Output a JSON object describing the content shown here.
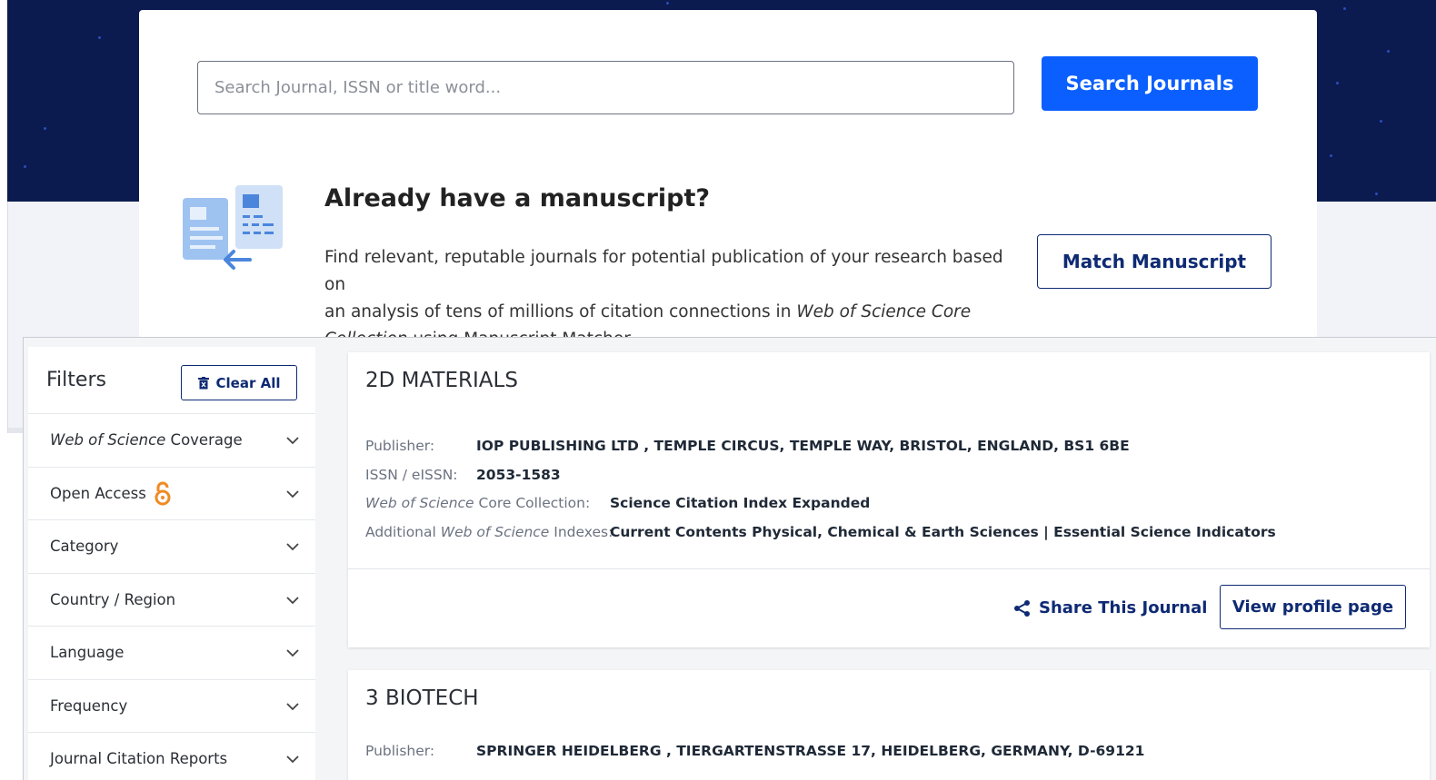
{
  "search": {
    "placeholder": "Search Journal, ISSN or title word...",
    "button_label": "Search Journals"
  },
  "manuscript": {
    "title": "Already have a manuscript?",
    "desc_line1": "Find relevant, reputable journals for potential publication of your research based on",
    "desc_line2_pre": "an analysis of tens of millions of citation connections in ",
    "desc_line2_em": "Web of Science Core",
    "desc_line3_em": "Collection",
    "desc_line3_post": " using Manuscript Matcher.",
    "button_label": "Match Manuscript"
  },
  "filters": {
    "title": "Filters",
    "clear_label": "Clear All",
    "items": [
      {
        "em": "Web of Science",
        "label": " Coverage"
      },
      {
        "label": "Open Access"
      },
      {
        "label": "Category"
      },
      {
        "label": "Country / Region"
      },
      {
        "label": "Language"
      },
      {
        "label": "Frequency"
      },
      {
        "label": "Journal Citation Reports"
      }
    ]
  },
  "journals": [
    {
      "title": "2D MATERIALS",
      "publisher_label": "Publisher:",
      "publisher": "IOP PUBLISHING LTD , TEMPLE CIRCUS, TEMPLE WAY, BRISTOL, ENGLAND, BS1 6BE",
      "issn_label": "ISSN / eISSN:",
      "issn": "2053-1583",
      "core_label_em": "Web of Science",
      "core_label_rest": " Core Collection:",
      "core": "Science Citation Index Expanded",
      "additional_label_pre": "Additional ",
      "additional_label_em": "Web of Science",
      "additional_label_post": " Indexes:",
      "additional": "Current Contents Physical, Chemical & Earth Sciences | Essential Science Indicators",
      "share_label": "Share This Journal",
      "view_label": "View profile page"
    },
    {
      "title": "3 BIOTECH",
      "publisher_label": "Publisher:",
      "publisher": "SPRINGER HEIDELBERG , TIERGARTENSTRASSE 17, HEIDELBERG, GERMANY, D-69121"
    }
  ],
  "colors": {
    "hero_bg": "#0b1b4f",
    "primary_button": "#0b5fff",
    "navy_text": "#0e2a73",
    "open_access_orange": "#f08a24"
  }
}
